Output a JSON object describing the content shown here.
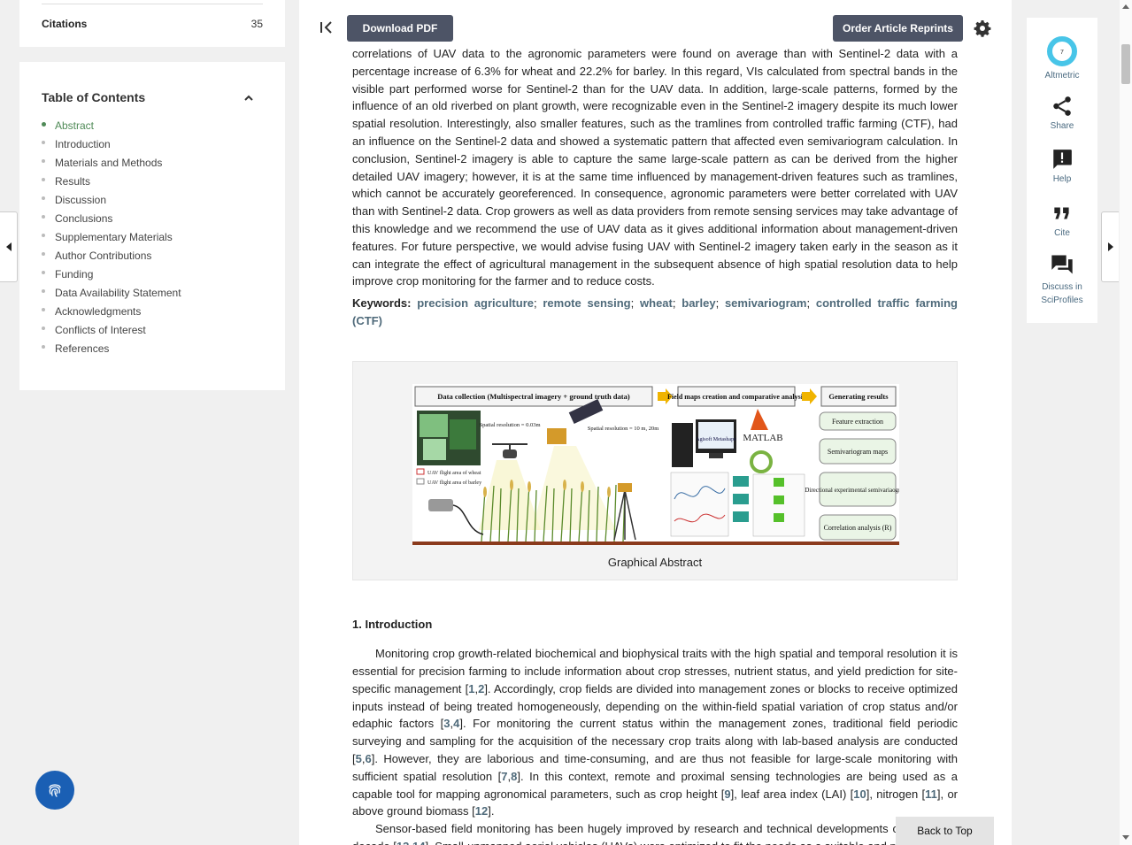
{
  "sidebar": {
    "citations_label": "Citations",
    "citations_count": "35",
    "toc_title": "Table of Contents",
    "toc_items": [
      "Abstract",
      "Introduction",
      "Materials and Methods",
      "Results",
      "Discussion",
      "Conclusions",
      "Supplementary Materials",
      "Author Contributions",
      "Funding",
      "Data Availability Statement",
      "Acknowledgments",
      "Conflicts of Interest",
      "References"
    ]
  },
  "toolbar": {
    "download_label": "Download PDF",
    "reprints_label": "Order Article Reprints"
  },
  "abstract": {
    "text": "correlations of UAV data to the agronomic parameters were found on average than with Sentinel-2 data with a percentage increase of 6.3% for wheat and 22.2% for barley. In this regard, VIs calculated from spectral bands in the visible part performed worse for Sentinel-2 than for the UAV data. In addition, large-scale patterns, formed by the influence of an old riverbed on plant growth, were recognizable even in the Sentinel-2 imagery despite its much lower spatial resolution. Interestingly, also smaller features, such as the tramlines from controlled traffic farming (CTF), had an influence on the Sentinel-2 data and showed a systematic pattern that affected even semivariogram calculation. In conclusion, Sentinel-2 imagery is able to capture the same large-scale pattern as can be derived from the higher detailed UAV imagery; however, it is at the same time influenced by management-driven features such as tramlines, which cannot be accurately georeferenced. In consequence, agronomic parameters were better correlated with UAV than with Sentinel-2 data. Crop growers as well as data providers from remote sensing services may take advantage of this knowledge and we recommend the use of UAV data as it gives additional information about management-driven features. For future perspective, we would advise fusing UAV with Sentinel-2 imagery taken early in the season as it can integrate the effect of agricultural management in the subsequent absence of high spatial resolution data to help improve crop monitoring for the farmer and to reduce costs."
  },
  "keywords": {
    "label": "Keywords:",
    "items": [
      "precision agriculture",
      "remote sensing",
      "wheat",
      "barley",
      "semivariogram",
      "controlled traffic farming (CTF)"
    ],
    "separator": "; "
  },
  "graphical_abstract": {
    "caption": "Graphical Abstract",
    "panel_1": "Data collection (Multispectral imagery + ground truth data)",
    "panel_2": "Field maps creation and comparative analysis",
    "panel_3": "Generating results",
    "uav_res": "Spatial resolution = 0.03m",
    "s2_res": "Spatial resolution = 10 m, 20m",
    "legend_wheat": "UAV flight area of wheat",
    "legend_barley": "UAV flight area of barley",
    "agisoft": "Agisoft Metashape",
    "matlab": "MATLAB",
    "result_1": "Feature extraction",
    "result_2": "Semivariogram maps",
    "result_3": "Directional experimental semivariaograms",
    "result_4": "Correlation analysis (R)"
  },
  "introduction": {
    "title": "1. Introduction",
    "p1": [
      {
        "t": "Monitoring crop growth-related biochemical and biophysical traits with the high spatial and temporal resolution it is essential for precision farming to include information about crop stresses, nutrient status, and yield prediction for site-specific management ["
      },
      {
        "r": "1"
      },
      {
        "t": ","
      },
      {
        "r": "2"
      },
      {
        "t": "]. Accordingly, crop fields are divided into management zones or blocks to receive optimized inputs instead of being treated homogeneously, depending on the within-field spatial variation of crop status and/or edaphic factors ["
      },
      {
        "r": "3"
      },
      {
        "t": ","
      },
      {
        "r": "4"
      },
      {
        "t": "]. For monitoring the current status within the management zones, traditional field periodic surveying and sampling for the acquisition of the necessary crop traits along with lab-based analysis are conducted ["
      },
      {
        "r": "5"
      },
      {
        "t": ","
      },
      {
        "r": "6"
      },
      {
        "t": "]. However, they are laborious and time-consuming, and are thus not feasible for large-scale monitoring with sufficient spatial resolution ["
      },
      {
        "r": "7"
      },
      {
        "t": ","
      },
      {
        "r": "8"
      },
      {
        "t": "]. In this context, remote and proximal sensing technologies are being used as a capable tool for mapping agronomical parameters, such as crop height ["
      },
      {
        "r": "9"
      },
      {
        "t": "], leaf area index (LAI) ["
      },
      {
        "r": "10"
      },
      {
        "t": "], nitrogen ["
      },
      {
        "r": "11"
      },
      {
        "t": "], or above ground biomass ["
      },
      {
        "r": "12"
      },
      {
        "t": "]."
      }
    ],
    "p2": [
      {
        "t": "Sensor-based field monitoring has been hugely improved by research and technical developments over the last decade ["
      },
      {
        "r": "13"
      },
      {
        "t": ","
      },
      {
        "r": "14"
      },
      {
        "t": "]. Small-unmanned aerial vehicles (UAVs) were optimized to fit the needs as a suitable and powerful"
      }
    ]
  },
  "right_panel": {
    "altmetric_label": "Altmetric",
    "altmetric_score": "7",
    "share_label": "Share",
    "help_label": "Help",
    "cite_label": "Cite",
    "discuss_label": "Discuss in SciProfiles"
  },
  "back_to_top": "Back to Top",
  "colors": {
    "accent_green": "#4f8a57",
    "link": "#4f6a7a",
    "button_dark": "#4d5466",
    "fingerprint_blue": "#1a5fb4"
  }
}
